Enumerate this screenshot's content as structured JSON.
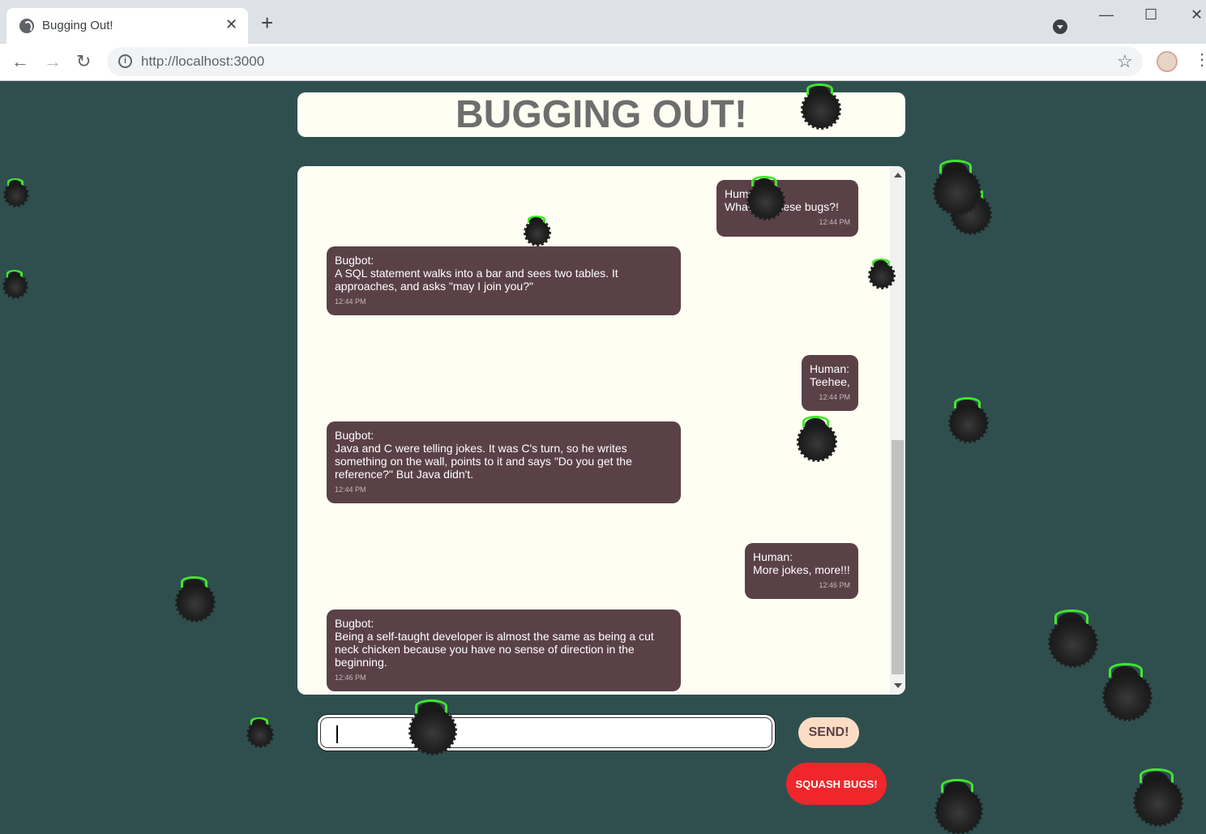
{
  "browser": {
    "tab_title": "Bugging Out!",
    "tab_close": "✕",
    "new_tab": "+",
    "url": "http://localhost:3000",
    "minimize": "—",
    "maximize": "☐",
    "close": "✕",
    "back": "←",
    "forward": "→",
    "reload": "↻",
    "info": "i",
    "star": "☆",
    "menu": "⋮"
  },
  "app": {
    "title": "BUGGING OUT!",
    "messages": [
      {
        "sender": "Human:",
        "text": "What are these bugs?!",
        "time": "12:44 PM"
      },
      {
        "sender": "Bugbot:",
        "text": "A SQL statement walks into a bar and sees two tables. It approaches, and asks \"may I join you?\"",
        "time": "12:44 PM"
      },
      {
        "sender": "Human:",
        "text": "Teehee,",
        "time": "12:44 PM"
      },
      {
        "sender": "Bugbot:",
        "text": "Java and C were telling jokes. It was C's turn, so he writes something on the wall, points to it and says \"Do you get the reference?\" But Java didn't.",
        "time": "12:44 PM"
      },
      {
        "sender": "Human:",
        "text": "More jokes, more!!!",
        "time": "12:46 PM"
      },
      {
        "sender": "Bugbot:",
        "text": "Being a self-taught developer is almost the same as being a cut neck chicken because you have no sense of direction in the beginning.",
        "time": "12:46 PM"
      }
    ],
    "input_value": "",
    "send_label": "SEND!",
    "squash_label": "SQUASH BUGS!"
  },
  "colors": {
    "background": "#2f4f4f",
    "panel": "#fffef2",
    "bubble": "#5a4148",
    "send": "#fcdcc4",
    "squash": "#f0262a",
    "bug_antenna": "#43e62c"
  },
  "icons": [
    "globe-icon",
    "close-icon",
    "plus-icon",
    "back-icon",
    "forward-icon",
    "reload-icon",
    "info-icon",
    "star-icon",
    "menu-icon",
    "bug-icon"
  ]
}
